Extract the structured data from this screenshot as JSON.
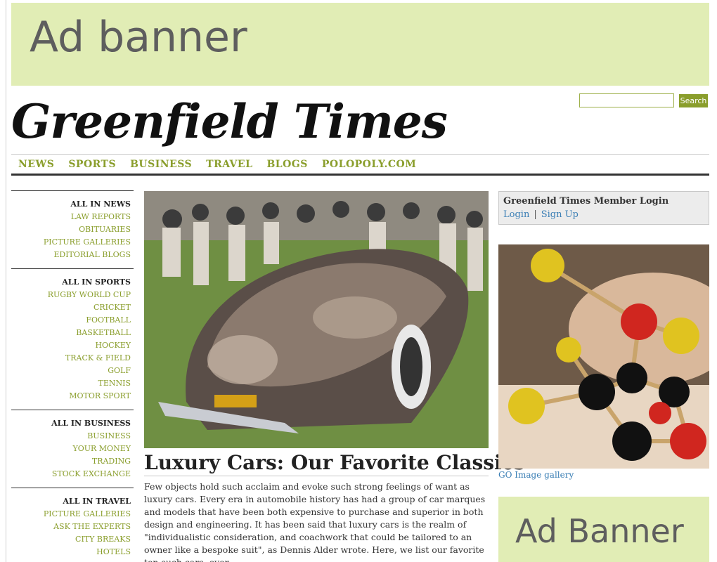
{
  "ads": {
    "top_label": "Ad banner",
    "right_label": "Ad Banner"
  },
  "masthead": {
    "title": "Greenfield Times"
  },
  "search": {
    "placeholder": "",
    "button_label": "Search"
  },
  "nav": {
    "items": [
      "NEWS",
      "SPORTS",
      "BUSINESS",
      "TRAVEL",
      "BLOGS",
      "POLOPOLY.COM"
    ]
  },
  "sidebar": {
    "sections": [
      {
        "heading": "ALL IN NEWS",
        "links": [
          "LAW REPORTS",
          "OBITUARIES",
          "PICTURE GALLERIES",
          "EDITORIAL BLOGS"
        ]
      },
      {
        "heading": "ALL IN SPORTS",
        "links": [
          "RUGBY WORLD CUP",
          "CRICKET",
          "FOOTBALL",
          "BASKETBALL",
          "HOCKEY",
          "TRACK & FIELD",
          "GOLF",
          "TENNIS",
          "MOTOR SPORT"
        ]
      },
      {
        "heading": "ALL IN BUSINESS",
        "links": [
          "BUSINESS",
          "YOUR MONEY",
          "TRADING",
          "STOCK EXCHANGE"
        ]
      },
      {
        "heading": "ALL IN TRAVEL",
        "links": [
          "PICTURE GALLERIES",
          "ASK THE EXPERTS",
          "CITY BREAKS",
          "HOTELS"
        ]
      }
    ]
  },
  "article": {
    "headline": "Luxury Cars: Our Favorite Classics",
    "body": "Few objects hold such acclaim and evoke such strong feelings of want as luxury cars. Every era in automobile history has had a group of car marques and models that have been both expensive to purchase and superior in both design and engineering. It has been said that luxury cars is the realm of \"individualistic consideration, and coachwork that could be tailored to an owner like a bespoke suit\", as Dennis Alder wrote. Here, we list our favorite ten such cars, ever."
  },
  "login": {
    "title": "Greenfield Times Member Login",
    "login_label": "Login",
    "separator": "|",
    "signup_label": "Sign Up"
  },
  "gallery": {
    "link_label": "GO Image gallery"
  },
  "colors": {
    "accent_green": "#8a9e2c",
    "ad_bg": "#e1edb5",
    "link_blue": "#3b7fb5"
  }
}
